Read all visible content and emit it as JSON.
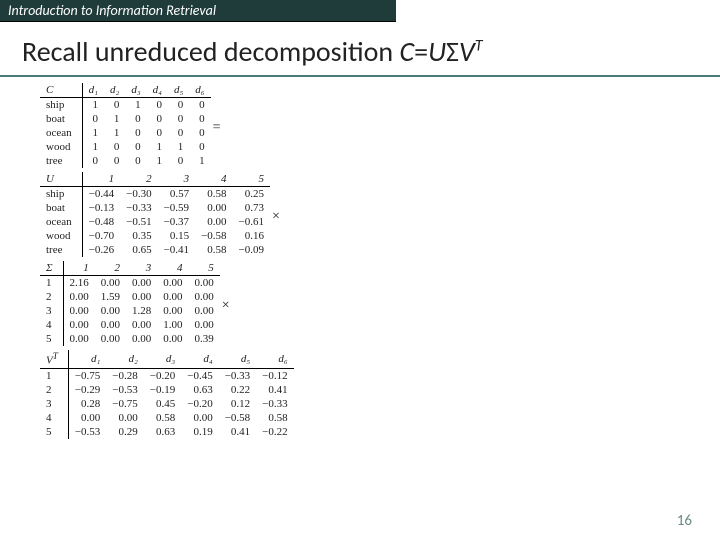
{
  "header": {
    "course": "Introduction to Information Retrieval"
  },
  "title": {
    "prefix": "Recall unreduced decomposition ",
    "eq_lhs": "C",
    "eq_eq": "=",
    "eq_u": "U",
    "eq_sigma": "Σ",
    "eq_v": "V",
    "eq_sup": "T"
  },
  "labels": {
    "C": "C",
    "U": "U",
    "Sigma": "Σ",
    "VT_v": "V",
    "VT_sup": "T",
    "eq": "=",
    "times": "×"
  },
  "C": {
    "cols": [
      "d₁",
      "d₂",
      "d₃",
      "d₄",
      "d₅",
      "d₆"
    ],
    "rows": [
      "ship",
      "boat",
      "ocean",
      "wood",
      "tree"
    ],
    "vals": [
      [
        1,
        0,
        1,
        0,
        0,
        0
      ],
      [
        0,
        1,
        0,
        0,
        0,
        0
      ],
      [
        1,
        1,
        0,
        0,
        0,
        0
      ],
      [
        1,
        0,
        0,
        1,
        1,
        0
      ],
      [
        0,
        0,
        0,
        1,
        0,
        1
      ]
    ]
  },
  "U": {
    "cols": [
      "1",
      "2",
      "3",
      "4",
      "5"
    ],
    "rows": [
      "ship",
      "boat",
      "ocean",
      "wood",
      "tree"
    ],
    "vals": [
      [
        "−0.44",
        "−0.30",
        "0.57",
        "0.58",
        "0.25"
      ],
      [
        "−0.13",
        "−0.33",
        "−0.59",
        "0.00",
        "0.73"
      ],
      [
        "−0.48",
        "−0.51",
        "−0.37",
        "0.00",
        "−0.61"
      ],
      [
        "−0.70",
        "0.35",
        "0.15",
        "−0.58",
        "0.16"
      ],
      [
        "−0.26",
        "0.65",
        "−0.41",
        "0.58",
        "−0.09"
      ]
    ]
  },
  "Sigma": {
    "cols": [
      "1",
      "2",
      "3",
      "4",
      "5"
    ],
    "rows": [
      "1",
      "2",
      "3",
      "4",
      "5"
    ],
    "vals": [
      [
        "2.16",
        "0.00",
        "0.00",
        "0.00",
        "0.00"
      ],
      [
        "0.00",
        "1.59",
        "0.00",
        "0.00",
        "0.00"
      ],
      [
        "0.00",
        "0.00",
        "1.28",
        "0.00",
        "0.00"
      ],
      [
        "0.00",
        "0.00",
        "0.00",
        "1.00",
        "0.00"
      ],
      [
        "0.00",
        "0.00",
        "0.00",
        "0.00",
        "0.39"
      ]
    ]
  },
  "VT": {
    "cols": [
      "d₁",
      "d₂",
      "d₃",
      "d₄",
      "d₅",
      "d₆"
    ],
    "rows": [
      "1",
      "2",
      "3",
      "4",
      "5"
    ],
    "vals": [
      [
        "−0.75",
        "−0.28",
        "−0.20",
        "−0.45",
        "−0.33",
        "−0.12"
      ],
      [
        "−0.29",
        "−0.53",
        "−0.19",
        "0.63",
        "0.22",
        "0.41"
      ],
      [
        "0.28",
        "−0.75",
        "0.45",
        "−0.20",
        "0.12",
        "−0.33"
      ],
      [
        "0.00",
        "0.00",
        "0.58",
        "0.00",
        "−0.58",
        "0.58"
      ],
      [
        "−0.53",
        "0.29",
        "0.63",
        "0.19",
        "0.41",
        "−0.22"
      ]
    ]
  },
  "page": "16"
}
